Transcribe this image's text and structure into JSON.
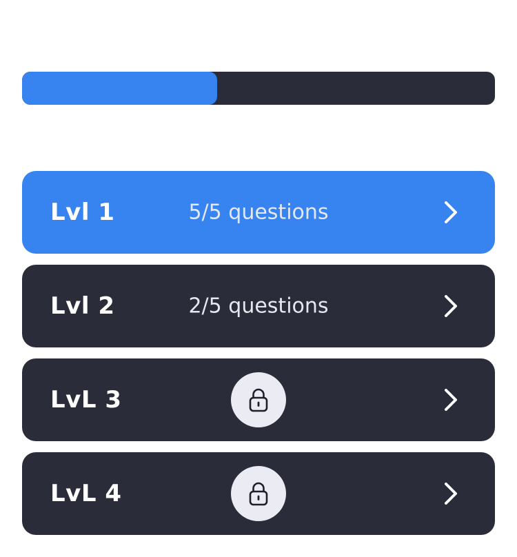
{
  "progress": {
    "fraction": 0.413
  },
  "colors": {
    "accent": "#3783ef",
    "dark": "#2a2c3a",
    "lock_bg": "#ebebf3"
  },
  "levels": [
    {
      "title": "Lvl 1",
      "progress_text": "5/5 questions",
      "locked": false,
      "active": true
    },
    {
      "title": "Lvl 2",
      "progress_text": "2/5 questions",
      "locked": false,
      "active": false
    },
    {
      "title": "LvL 3",
      "progress_text": "",
      "locked": true,
      "active": false,
      "icon": "lock-icon"
    },
    {
      "title": "LvL 4",
      "progress_text": "",
      "locked": true,
      "active": false,
      "icon": "lock-icon"
    }
  ],
  "chevron_icon": "chevron-right-icon"
}
